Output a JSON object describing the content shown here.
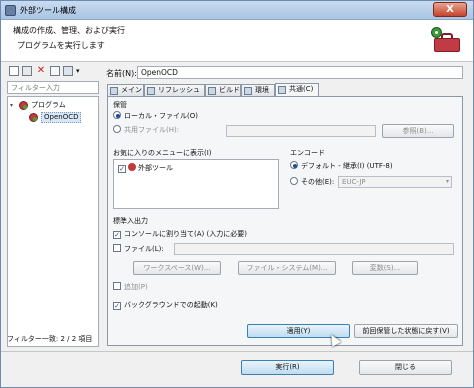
{
  "window": {
    "title": "外部ツール構成",
    "close_label": "X"
  },
  "header": {
    "title": "構成の作成、管理、および実行",
    "subtitle": "プログラムを実行します",
    "icon": "toolbox-icon"
  },
  "left": {
    "filter_placeholder": "フィルター入力",
    "tree": [
      {
        "label": "プログラム",
        "expanded": true
      },
      {
        "label": "OpenOCD",
        "selected": true
      }
    ],
    "status": "フィルター一致: 2 / 2 項目"
  },
  "form": {
    "name_label": "名前(N):",
    "name_value": "OpenOCD",
    "tabs": [
      "メイン",
      "リフレッシュ",
      "ビルド",
      "環境",
      "共通(C)"
    ],
    "active_tab": "共通(C)",
    "save_group": {
      "title": "保管",
      "local_label": "ローカル・ファイル(O)",
      "shared_label": "共用ファイル(H):",
      "browse_label": "参照(B)..."
    },
    "favorites": {
      "title": "お気に入りのメニューに表示(I)",
      "item": "外部ツール"
    },
    "encoding": {
      "title": "エンコード",
      "default_label": "デフォルト - 継承(I) (UTF-8)",
      "other_label": "その他(E):",
      "other_value": "EUC-JP"
    },
    "io": {
      "title": "標準入出力",
      "console_label": "コンソールに割り当て(A) (入力に必要)",
      "file_label": "ファイル(L):",
      "workspace_label": "ワークスペース(W)...",
      "filesystem_label": "ファイル・システム(M)...",
      "variables_label": "変数(S)...",
      "append_label": "追加(P)"
    },
    "background_label": "バックグラウンドでの起動(K)",
    "apply_label": "適用(Y)",
    "revert_label": "前回保管した状態に戻す(V)"
  },
  "footer": {
    "run_label": "実行(R)",
    "close_label": "閉じる"
  }
}
